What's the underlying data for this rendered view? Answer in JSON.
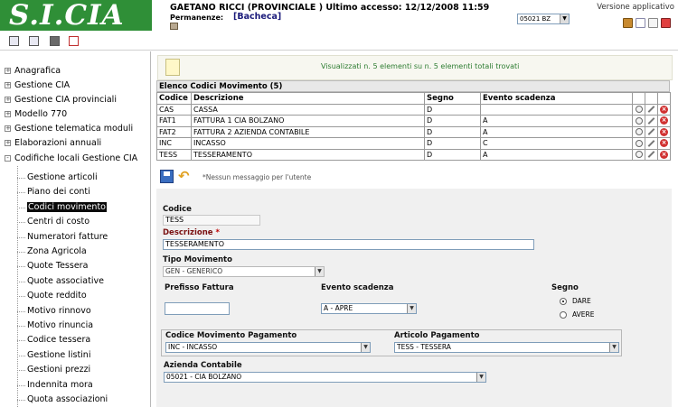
{
  "header": {
    "logo_text": "S.I.CIA",
    "user_line": "GAETANO RICCI (PROVINCIALE ) Ultimo accesso: 12/12/2008 11:59",
    "permanenze_label": "Permanenze:",
    "permanenze_value": "[Bacheca]",
    "org_selected": "05021 BZ",
    "versioni_label": "Versione applicativo",
    "brand_color": "#2f8f37"
  },
  "sidebar": {
    "groups": [
      {
        "label": "Anagrafica",
        "expander": "+"
      },
      {
        "label": "Gestione CIA",
        "expander": "+"
      },
      {
        "label": "Gestione CIA provinciali",
        "expander": "+"
      },
      {
        "label": "Modello 770",
        "expander": "+"
      },
      {
        "label": "Gestione telematica moduli",
        "expander": "+"
      },
      {
        "label": "Elaborazioni annuali",
        "expander": "+"
      },
      {
        "label": "Codifiche locali Gestione CIA",
        "expander": "-"
      }
    ],
    "sub_items": [
      "Gestione articoli",
      "Piano dei conti",
      "Codici movimento",
      "Centri di costo",
      "Numeratori fatture",
      "Zona Agricola",
      "Quote Tessera",
      "Quote associative",
      "Quote reddito",
      "Motivo rinnovo",
      "Motivo rinuncia",
      "Codice tessera",
      "Gestione listini",
      "Gestioni prezzi",
      "Indennita mora",
      "Quota associazioni"
    ],
    "selected_item": "Codici movimento"
  },
  "info": {
    "text": "Visualizzati n. 5 elementi su n. 5 elementi totali trovati"
  },
  "grid": {
    "title": "Elenco Codici Movimento (5)",
    "columns": [
      "Codice",
      "Descrizione",
      "Segno",
      "Evento scadenza"
    ],
    "rows": [
      {
        "codice": "CAS",
        "descrizione": "CASSA",
        "segno": "D",
        "evento": ""
      },
      {
        "codice": "FAT1",
        "descrizione": "FATTURA 1 CIA BOLZANO",
        "segno": "D",
        "evento": "A"
      },
      {
        "codice": "FAT2",
        "descrizione": "FATTURA 2 AZIENDA CONTABILE",
        "segno": "D",
        "evento": "A"
      },
      {
        "codice": "INC",
        "descrizione": "INCASSO",
        "segno": "D",
        "evento": "C"
      },
      {
        "codice": "TESS",
        "descrizione": "TESSERAMENTO",
        "segno": "D",
        "evento": "A"
      }
    ]
  },
  "form_bar": {
    "message": "*Nessun messaggio per l'utente"
  },
  "form": {
    "codice_label": "Codice",
    "codice_value": "TESS",
    "descrizione_label": "Descrizione",
    "descrizione_required": "*",
    "descrizione_value": "TESSERAMENTO",
    "tipo_label": "Tipo Movimento",
    "tipo_value": "GEN - GENERICO",
    "prefisso_label": "Prefisso Fattura",
    "prefisso_value": "",
    "evento_label": "Evento scadenza",
    "evento_value": "A - APRE",
    "segno_label": "Segno",
    "segno_options": [
      "DARE",
      "AVERE"
    ],
    "segno_selected": "DARE",
    "cod_pag_label": "Codice Movimento Pagamento",
    "cod_pag_value": "INC - INCASSO",
    "art_pag_label": "Articolo Pagamento",
    "art_pag_value": "TESS - TESSERA",
    "azienda_label": "Azienda Contabile",
    "azienda_value": "05021 - CIA BOLZANO"
  }
}
